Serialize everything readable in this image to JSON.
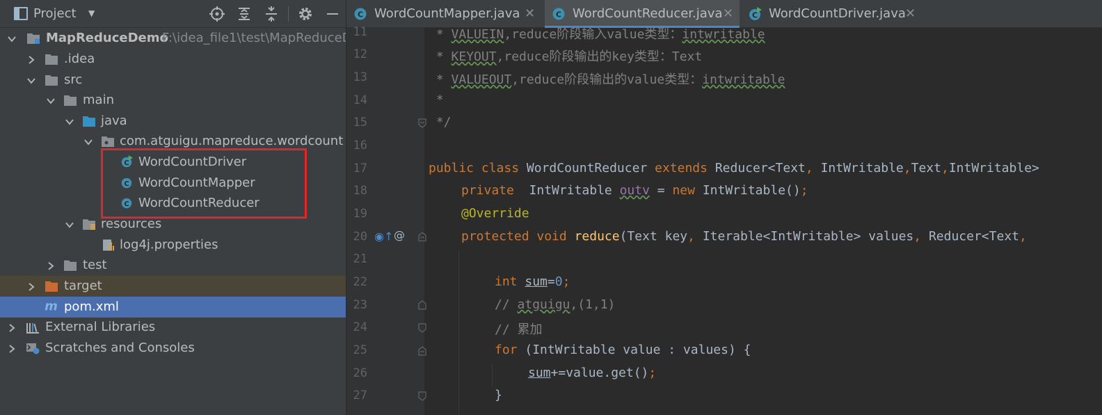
{
  "project_panel": {
    "title": "Project",
    "tree": [
      {
        "label": "MapReduceDemo",
        "path": "F:\\idea_file1\\test\\MapReduceD",
        "kind": "module"
      },
      {
        "label": ".idea",
        "kind": "folder"
      },
      {
        "label": "src",
        "kind": "folder"
      },
      {
        "label": "main",
        "kind": "folder"
      },
      {
        "label": "java",
        "kind": "source-folder"
      },
      {
        "label": "com.atguigu.mapreduce.wordcount",
        "kind": "package"
      },
      {
        "label": "WordCountDriver",
        "kind": "class-runnable"
      },
      {
        "label": "WordCountMapper",
        "kind": "class"
      },
      {
        "label": "WordCountReducer",
        "kind": "class"
      },
      {
        "label": "resources",
        "kind": "resources-folder"
      },
      {
        "label": "log4j.properties",
        "kind": "properties"
      },
      {
        "label": "test",
        "kind": "folder"
      },
      {
        "label": "target",
        "kind": "excluded-folder"
      },
      {
        "label": "pom.xml",
        "kind": "maven"
      },
      {
        "label": "External Libraries",
        "kind": "libraries"
      },
      {
        "label": "Scratches and Consoles",
        "kind": "scratches"
      }
    ],
    "selected": "pom.xml",
    "highlight_color": "#e0252b"
  },
  "editor": {
    "tabs": [
      {
        "label": "WordCountMapper.java"
      },
      {
        "label": "WordCountReducer.java",
        "active": true
      },
      {
        "label": "WordCountDriver.java"
      }
    ],
    "line_numbers": [
      "11",
      "12",
      "13",
      "14",
      "15",
      "16",
      "17",
      "18",
      "19",
      "20",
      "21",
      "22",
      "23",
      "24",
      "25",
      "26",
      "27"
    ],
    "code": {
      "l11_a": " * ",
      "l11_b": "VALUEIN",
      "l11_c": ",reduce阶段输入value类型：",
      "l11_d": "intwritable",
      "l12_a": " * ",
      "l12_b": "KEYOUT",
      "l12_c": ",reduce阶段输出的key类型：Text",
      "l13_a": " * ",
      "l13_b": "VALUEOUT",
      "l13_c": ",reduce阶段输出的value类型：",
      "l13_d": "intwritable",
      "l14": " *",
      "l15": " */",
      "l17_a": "public class ",
      "l17_b": "WordCountReducer ",
      "l17_c": "extends ",
      "l17_d": "Reducer<Text",
      "l17_e": ", ",
      "l17_f": "IntWritable",
      "l17_g": ",",
      "l17_h": "Text",
      "l17_i": ",",
      "l17_j": "IntWritable>",
      "l18_a": "private  ",
      "l18_b": "IntWritable ",
      "l18_c": "outv",
      "l18_d": " = ",
      "l18_e": "new ",
      "l18_f": "IntWritable()",
      "l18_g": ";",
      "l19": "@Override",
      "l20_a": "protected void ",
      "l20_b": "reduce",
      "l20_c": "(Text key",
      "l20_d": ", ",
      "l20_e": "Iterable<IntWritable> values",
      "l20_f": ", ",
      "l20_g": "Reducer<Text",
      "l20_h": ",",
      "l22_a": "int ",
      "l22_b": "sum",
      "l22_c": "=",
      "l22_d": "0",
      "l22_e": ";",
      "l23_a": "// ",
      "l23_b": "atguigu",
      "l23_c": ",(1,1)",
      "l24": "// 累加",
      "l25_a": "for ",
      "l25_b": "(IntWritable value : values) {",
      "l26_a": "sum",
      "l26_b": "+=value.get()",
      "l26_c": ";",
      "l27": "}"
    },
    "colors": {
      "keyword": "#cc7832",
      "comment": "#808080",
      "annotation": "#bbb529",
      "function": "#ffc66d",
      "number": "#6897bb",
      "field": "#9876aa",
      "plain": "#a9b7c6"
    }
  }
}
